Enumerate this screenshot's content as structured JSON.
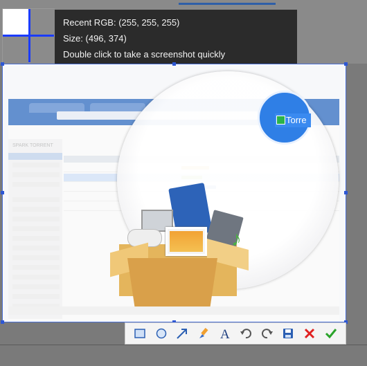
{
  "info": {
    "recent_rgb": "Recent RGB: (255, 255, 255)",
    "size": "Size: (496, 374)",
    "hint": "Double click to take a screenshot quickly"
  },
  "preview": {
    "app_name": "SPARK TORRENT",
    "lens_label": "Torre"
  },
  "toolbar": {
    "items": [
      "rectangle-tool",
      "ellipse-tool",
      "arrow-tool",
      "brush-tool",
      "text-tool",
      "undo",
      "redo",
      "save",
      "cancel",
      "confirm"
    ]
  },
  "colors": {
    "selection_border": "#4a6fd6",
    "handle": "#2d57d4",
    "cancel": "#e02020",
    "confirm": "#2aa32a",
    "info_bg": "#2b2b2b"
  }
}
